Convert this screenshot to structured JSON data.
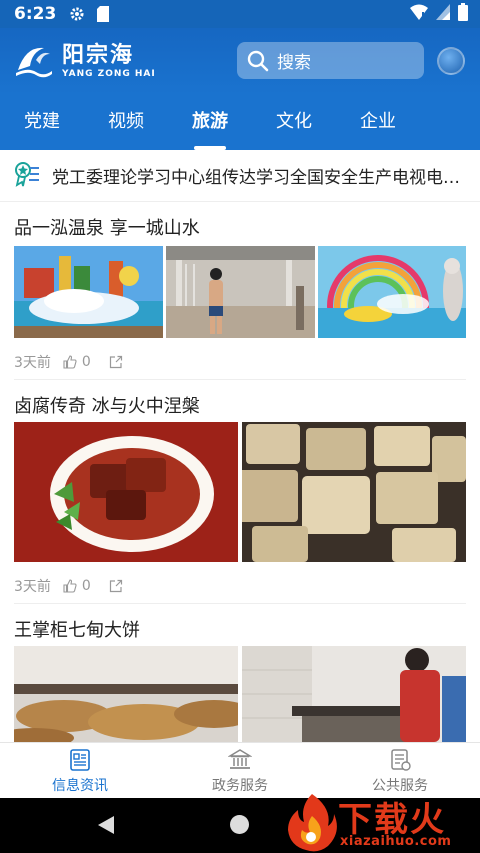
{
  "status_bar": {
    "time": "6:23"
  },
  "header": {
    "logo_cn": "阳宗海",
    "logo_en": "YANG ZONG HAI",
    "search_placeholder": "搜索"
  },
  "tabs": [
    {
      "label": "党建",
      "active": false
    },
    {
      "label": "视频",
      "active": false
    },
    {
      "label": "旅游",
      "active": true
    },
    {
      "label": "文化",
      "active": false
    },
    {
      "label": "企业",
      "active": false
    }
  ],
  "notice": {
    "text": "党工委理论学习中心组传达学习全国安全生产电视电话会议精神"
  },
  "articles": [
    {
      "title": "品一泓温泉 享一城山水",
      "time": "3天前",
      "likes": "0",
      "images": [
        "waterpark-splash-image",
        "shower-boy-image",
        "rainbow-waterslide-image"
      ]
    },
    {
      "title": "卤腐传奇 冰与火中涅槃",
      "time": "3天前",
      "likes": "0",
      "images": [
        "braised-tofu-dish-image",
        "tofu-cubes-image"
      ]
    },
    {
      "title": "王掌柜七甸大饼",
      "images": [
        "flatbread-image",
        "baker-kitchen-image"
      ]
    }
  ],
  "bottom_nav": [
    {
      "label": "信息资讯",
      "icon": "news-icon",
      "active": true
    },
    {
      "label": "政务服务",
      "icon": "government-building-icon",
      "active": false
    },
    {
      "label": "公共服务",
      "icon": "service-document-icon",
      "active": false
    }
  ],
  "watermark": {
    "title": "下载火",
    "url": "xiazaihuo.com"
  },
  "colors": {
    "primary": "#1a73cf",
    "accent_red": "#e23a1a"
  }
}
